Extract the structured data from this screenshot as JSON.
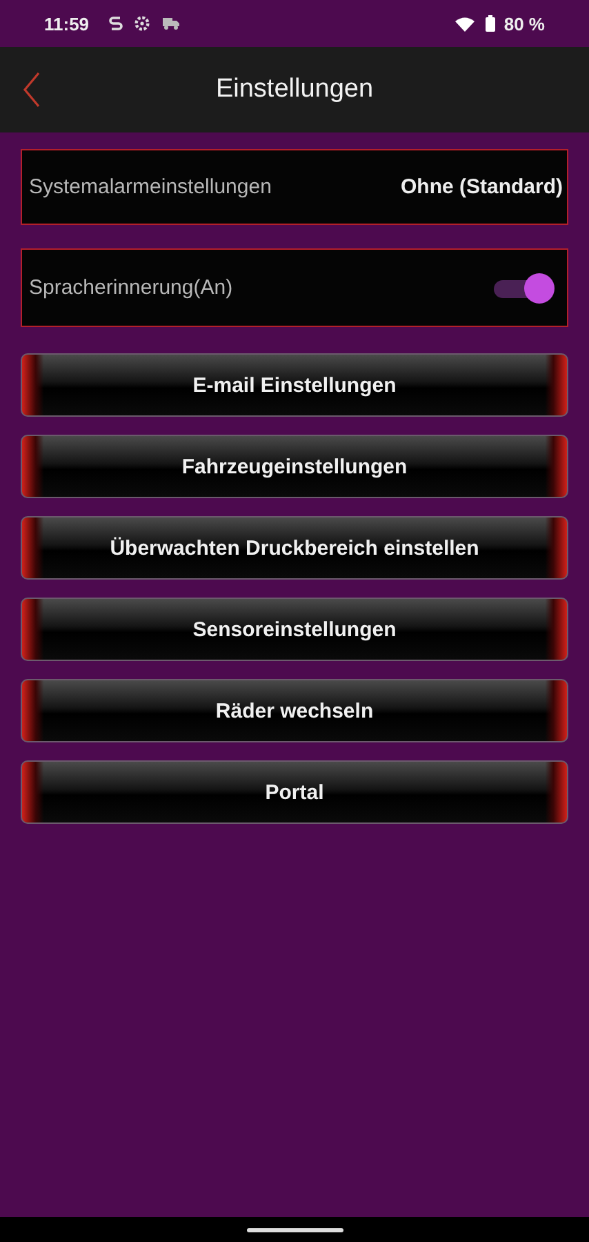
{
  "status_bar": {
    "time": "11:59",
    "battery": "80 %"
  },
  "header": {
    "title": "Einstellungen"
  },
  "settings": [
    {
      "kind": "value",
      "label": "Systemalarmeinstellungen",
      "value": "Ohne (Standard)"
    },
    {
      "kind": "toggle",
      "label": "Spracherinnerung(An)",
      "on": true
    }
  ],
  "buttons": [
    "E-mail Einstellungen",
    "Fahrzeugeinstellungen",
    "Überwachten Druckbereich einstellen",
    "Sensoreinstellungen",
    "Räder wechseln",
    "Portal"
  ]
}
